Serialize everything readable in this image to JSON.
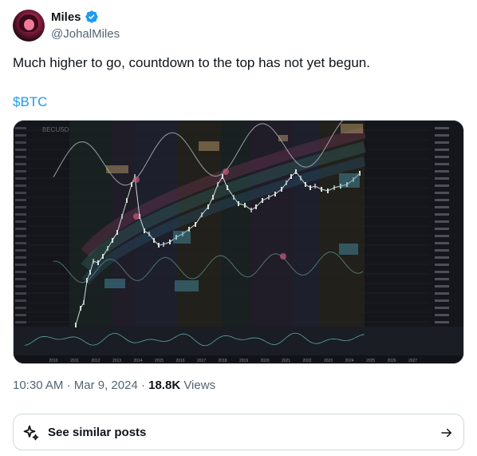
{
  "author": {
    "display_name": "Miles",
    "handle": "@JohalMiles",
    "verified": true
  },
  "tweet": {
    "text": "Much higher to go, countdown to the top has not yet begun.",
    "cashtag": "$BTC"
  },
  "chart_image": {
    "watermark": "BECUSD",
    "x_tick_labels": [
      "2010",
      "2011",
      "2012",
      "2013",
      "2014",
      "2015",
      "2016",
      "2017",
      "2018",
      "2019",
      "2020",
      "2021",
      "2022",
      "2023",
      "2024",
      "2025",
      "2026",
      "2027"
    ]
  },
  "meta": {
    "time": "10:30 AM",
    "date": "Mar 9, 2024",
    "views_count": "18.8K",
    "views_label": "Views"
  },
  "see_similar": {
    "label": "See similar posts"
  },
  "colors": {
    "link": "#1d9bf0",
    "verified": "#1d9bf0",
    "secondary_text": "#536471",
    "chart_bg": "#14161c"
  },
  "icons": {
    "verified": "verified-badge-icon",
    "sparkle": "sparkle-icon",
    "arrow": "arrow-right-icon"
  }
}
